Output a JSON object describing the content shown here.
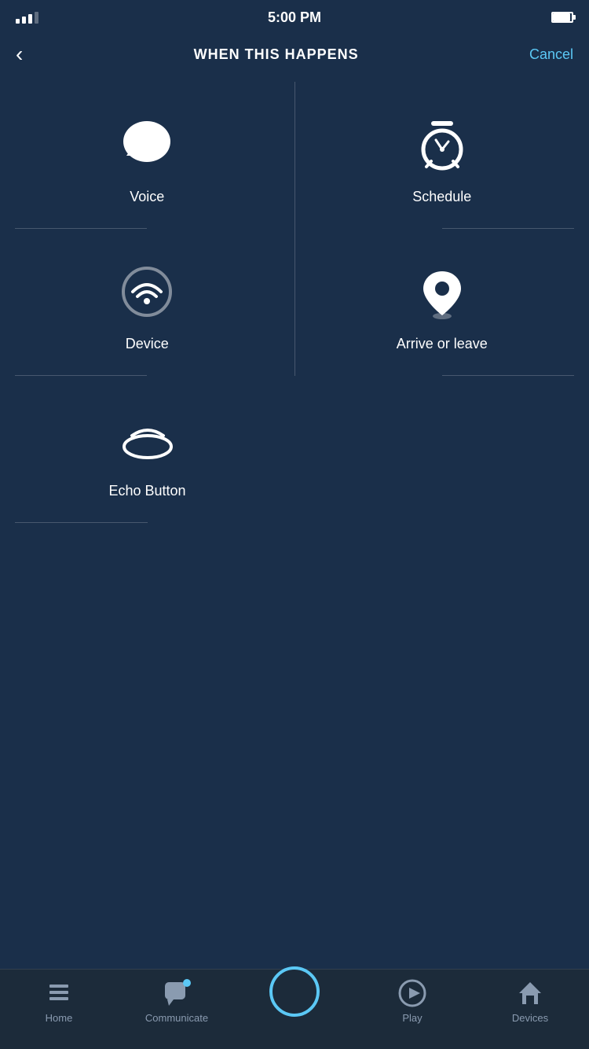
{
  "statusBar": {
    "time": "5:00 PM"
  },
  "header": {
    "title": "WHEN THIS HAPPENS",
    "backLabel": "<",
    "cancelLabel": "Cancel"
  },
  "options": [
    {
      "id": "voice",
      "label": "Voice",
      "iconType": "voice"
    },
    {
      "id": "schedule",
      "label": "Schedule",
      "iconType": "schedule"
    },
    {
      "id": "device",
      "label": "Device",
      "iconType": "device"
    },
    {
      "id": "arrive-or-leave",
      "label": "Arrive or leave",
      "iconType": "location"
    },
    {
      "id": "echo-button",
      "label": "Echo Button",
      "iconType": "echo"
    }
  ],
  "bottomNav": {
    "items": [
      {
        "id": "home",
        "label": "Home",
        "active": false
      },
      {
        "id": "communicate",
        "label": "Communicate",
        "active": false,
        "hasDot": true
      },
      {
        "id": "alexa",
        "label": "",
        "active": false,
        "isAlexa": true
      },
      {
        "id": "play",
        "label": "Play",
        "active": false
      },
      {
        "id": "devices",
        "label": "Devices",
        "active": false
      }
    ]
  }
}
